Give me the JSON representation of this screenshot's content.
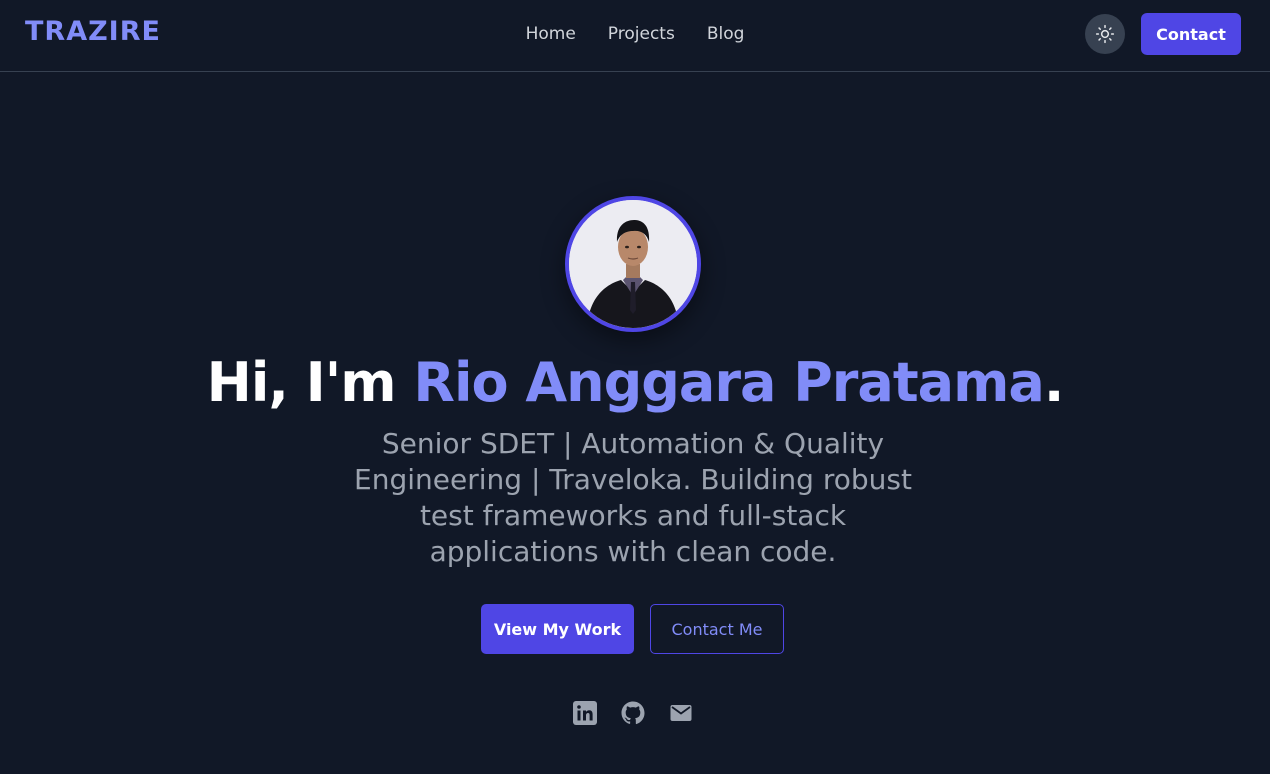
{
  "brand": "TRAZIRE",
  "nav": {
    "links": [
      {
        "label": "Home"
      },
      {
        "label": "Projects"
      },
      {
        "label": "Blog"
      }
    ],
    "theme_icon": "sun-icon",
    "contact_label": "Contact"
  },
  "hero": {
    "avatar_icon": "profile-photo",
    "greeting": "Hi, I'm ",
    "name": "Rio Anggara Pratama",
    "period": ".",
    "subtitle": "Senior SDET | Automation & Quality Engineering | Traveloka. Building robust test frameworks and full-stack applications with clean code.",
    "primary_button": "View My Work",
    "secondary_button": "Contact Me"
  },
  "social": [
    {
      "icon": "linkedin-icon"
    },
    {
      "icon": "github-icon"
    },
    {
      "icon": "mail-icon"
    }
  ],
  "colors": {
    "background": "#111827",
    "accent": "#4f46e5",
    "accent_light": "#818cf8",
    "muted_text": "#9ca3af"
  }
}
